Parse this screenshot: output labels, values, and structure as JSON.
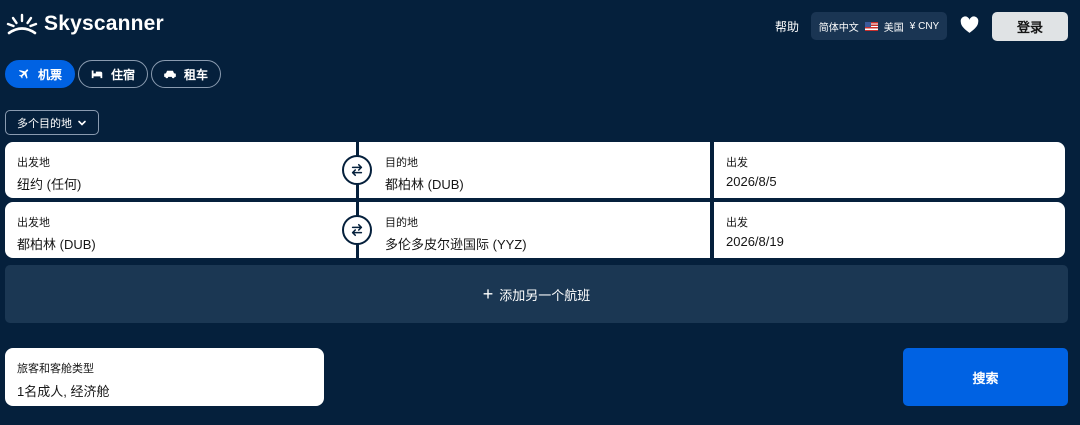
{
  "header": {
    "brand": "Skyscanner",
    "help_label": "帮助",
    "locale": {
      "language": "简体中文",
      "region": "美国",
      "currency": "¥ CNY"
    },
    "login_label": "登录"
  },
  "tabs": [
    {
      "label": "机票",
      "icon": "plane-icon",
      "active": true
    },
    {
      "label": "住宿",
      "icon": "bed-icon",
      "active": false
    },
    {
      "label": "租车",
      "icon": "car-icon",
      "active": false
    }
  ],
  "trip_type": {
    "selected": "多个目的地"
  },
  "legs": [
    {
      "origin_label": "出发地",
      "origin": "纽约 (任何)",
      "dest_label": "目的地",
      "dest": "都柏林 (DUB)",
      "date_label": "出发",
      "date": "2026/8/5"
    },
    {
      "origin_label": "出发地",
      "origin": "都柏林 (DUB)",
      "dest_label": "目的地",
      "dest": "多伦多皮尔逊国际 (YYZ)",
      "date_label": "出发",
      "date": "2026/8/19"
    }
  ],
  "add_flight_label": "添加另一个航班",
  "travellers": {
    "label": "旅客和客舱类型",
    "value": "1名成人, 经济舱"
  },
  "search_label": "搜索",
  "colors": {
    "background": "#05203c",
    "accent": "#0062e3",
    "panel": "#1b3753"
  }
}
